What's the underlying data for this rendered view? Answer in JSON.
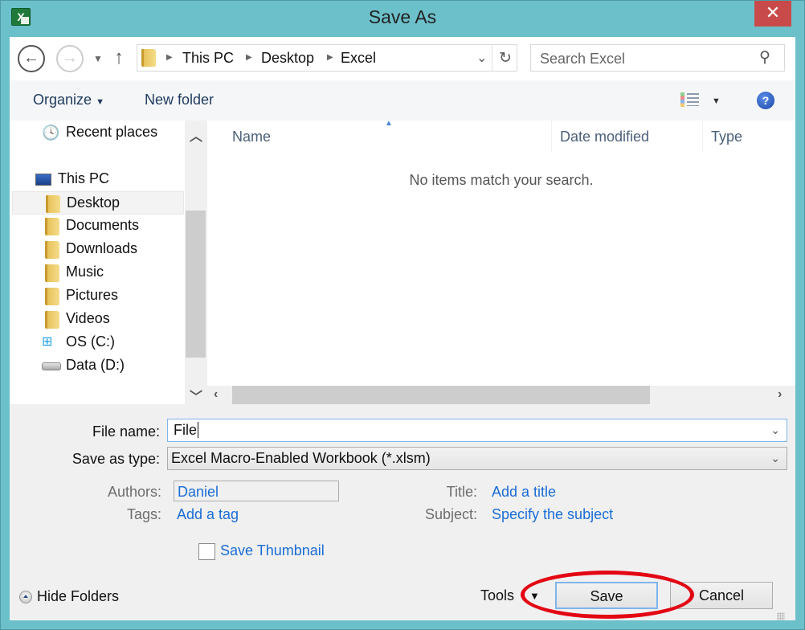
{
  "window": {
    "title": "Save As",
    "app_icon": "excel-icon",
    "close_icon": "close-icon"
  },
  "navigation": {
    "back_icon": "back-arrow-icon",
    "forward_icon": "forward-arrow-icon",
    "recent_icon": "chevron-down-icon",
    "up_icon": "up-arrow-icon",
    "breadcrumb": [
      "This PC",
      "Desktop",
      "Excel"
    ],
    "refresh_icon": "refresh-icon",
    "search_placeholder": "Search Excel",
    "search_icon": "search-icon"
  },
  "toolbar": {
    "organize_label": "Organize",
    "new_folder_label": "New folder",
    "view_icon": "details-view-icon",
    "help_icon": "help-icon"
  },
  "nav_pane": {
    "items": [
      {
        "label": "Recent places",
        "icon": "recent-places-icon"
      },
      {
        "label": "This PC",
        "icon": "computer-icon"
      },
      {
        "label": "Desktop",
        "icon": "desktop-folder-icon",
        "selected": true
      },
      {
        "label": "Documents",
        "icon": "documents-folder-icon"
      },
      {
        "label": "Downloads",
        "icon": "downloads-folder-icon"
      },
      {
        "label": "Music",
        "icon": "music-folder-icon"
      },
      {
        "label": "Pictures",
        "icon": "pictures-folder-icon"
      },
      {
        "label": "Videos",
        "icon": "videos-folder-icon"
      },
      {
        "label": "OS (C:)",
        "icon": "system-drive-icon"
      },
      {
        "label": "Data (D:)",
        "icon": "drive-icon"
      }
    ]
  },
  "file_list": {
    "columns": [
      "Name",
      "Date modified",
      "Type"
    ],
    "sort_column": "Name",
    "empty_message": "No items match your search."
  },
  "form": {
    "file_name_label": "File name:",
    "file_name_value": "File",
    "save_type_label": "Save as type:",
    "save_type_value": "Excel Macro-Enabled Workbook (*.xlsm)",
    "authors_label": "Authors:",
    "authors_value": "Daniel",
    "tags_label": "Tags:",
    "tags_value": "Add a tag",
    "title_label": "Title:",
    "title_value": "Add a title",
    "subject_label": "Subject:",
    "subject_value": "Specify the subject",
    "save_thumbnail_label": "Save Thumbnail",
    "save_thumbnail_checked": false
  },
  "footer": {
    "hide_folders_label": "Hide Folders",
    "tools_label": "Tools",
    "save_label": "Save",
    "cancel_label": "Cancel"
  },
  "annotation": {
    "highlight_color": "#e30613",
    "highlighted_target": "Save"
  }
}
